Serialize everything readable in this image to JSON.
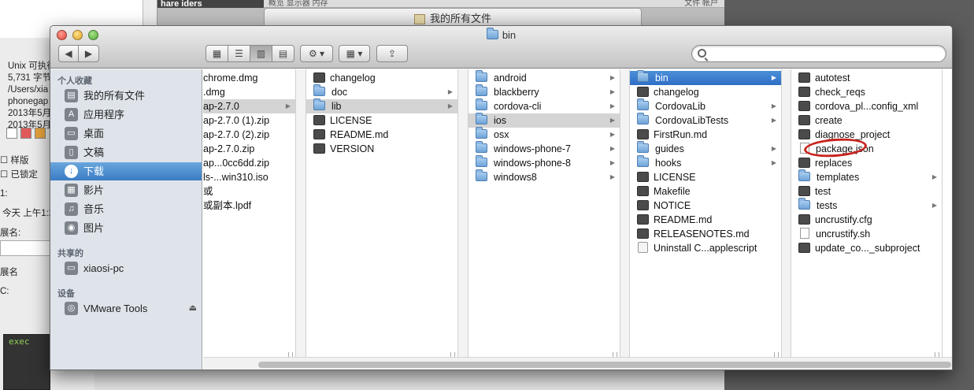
{
  "background": {
    "strip_text": "hare  iders",
    "top_bar_left": "概览  显示器  内存",
    "top_bar_right": "文件   帐户",
    "window2_title": "我的所有文件",
    "info_lines": "Unix 可执行\n5,731 字节\n/Users/xia\nphonegap\n2013年5月\n2013年5月",
    "chk_template": "样版",
    "chk_locked": "已锁定",
    "label_where": "1:",
    "label_today": "今天 上午1:2",
    "label_ext": "展名:",
    "label_ext2": "展名",
    "label_c": "C:",
    "terminal_text": "exec"
  },
  "window": {
    "title": "bin",
    "toolbar": {
      "back": "◀",
      "forward": "▶",
      "view_icon": "▦",
      "view_list": "☰",
      "view_column": "▥",
      "view_coverflow": "▤",
      "action": "⚙ ▾",
      "arrange": "▦ ▾",
      "share": "⇪"
    },
    "search": {
      "value": "",
      "placeholder": ""
    }
  },
  "sidebar": {
    "favorites_header": "个人收藏",
    "favorites": [
      {
        "label": "我的所有文件",
        "icon": "▤"
      },
      {
        "label": "应用程序",
        "icon": "A"
      },
      {
        "label": "桌面",
        "icon": "▭"
      },
      {
        "label": "文稿",
        "icon": "▯"
      },
      {
        "label": "下载",
        "icon": "↓"
      },
      {
        "label": "影片",
        "icon": "▦"
      },
      {
        "label": "音乐",
        "icon": "♫"
      },
      {
        "label": "图片",
        "icon": "◉"
      }
    ],
    "shared_header": "共享的",
    "shared": [
      {
        "label": "xiaosi-pc",
        "icon": "▭"
      }
    ],
    "devices_header": "设备",
    "devices": [
      {
        "label": "VMware Tools",
        "icon": "◎",
        "eject": "⏏"
      }
    ]
  },
  "columns": [
    {
      "items": [
        {
          "label": "chrome.dmg"
        },
        {
          "label": ".dmg"
        },
        {
          "label": "ap-2.7.0",
          "arrow": "▶",
          "sel": "grey"
        },
        {
          "label": "ap-2.7.0 (1).zip"
        },
        {
          "label": "ap-2.7.0 (2).zip"
        },
        {
          "label": "ap-2.7.0.zip"
        },
        {
          "label": "ap...0cc6dd.zip"
        },
        {
          "label": "ls-...win310.iso"
        },
        {
          "label": "或"
        },
        {
          "label": "或副本.lpdf"
        }
      ]
    },
    {
      "items": [
        {
          "label": "changelog",
          "kind": "file"
        },
        {
          "label": "doc",
          "kind": "folder",
          "arrow": "▶"
        },
        {
          "label": "lib",
          "kind": "folder",
          "arrow": "▶",
          "sel": "grey"
        },
        {
          "label": "LICENSE",
          "kind": "file"
        },
        {
          "label": "README.md",
          "kind": "file"
        },
        {
          "label": "VERSION",
          "kind": "file"
        }
      ]
    },
    {
      "items": [
        {
          "label": "android",
          "kind": "folder",
          "arrow": "▶"
        },
        {
          "label": "blackberry",
          "kind": "folder",
          "arrow": "▶"
        },
        {
          "label": "cordova-cli",
          "kind": "folder",
          "arrow": "▶"
        },
        {
          "label": "ios",
          "kind": "folder",
          "arrow": "▶",
          "sel": "grey"
        },
        {
          "label": "osx",
          "kind": "folder",
          "arrow": "▶"
        },
        {
          "label": "windows-phone-7",
          "kind": "folder",
          "arrow": "▶"
        },
        {
          "label": "windows-phone-8",
          "kind": "folder",
          "arrow": "▶"
        },
        {
          "label": "windows8",
          "kind": "folder",
          "arrow": "▶"
        }
      ]
    },
    {
      "items": [
        {
          "label": "bin",
          "kind": "folder",
          "arrow": "▶",
          "sel": "blue"
        },
        {
          "label": "changelog",
          "kind": "file"
        },
        {
          "label": "CordovaLib",
          "kind": "folder",
          "arrow": "▶"
        },
        {
          "label": "CordovaLibTests",
          "kind": "folder",
          "arrow": "▶"
        },
        {
          "label": "FirstRun.md",
          "kind": "file"
        },
        {
          "label": "guides",
          "kind": "folder",
          "arrow": "▶"
        },
        {
          "label": "hooks",
          "kind": "folder",
          "arrow": "▶"
        },
        {
          "label": "LICENSE",
          "kind": "file"
        },
        {
          "label": "Makefile",
          "kind": "file"
        },
        {
          "label": "NOTICE",
          "kind": "file"
        },
        {
          "label": "README.md",
          "kind": "file"
        },
        {
          "label": "RELEASENOTES.md",
          "kind": "file"
        },
        {
          "label": "Uninstall C...applescript",
          "kind": "script"
        }
      ]
    },
    {
      "items": [
        {
          "label": "autotest",
          "kind": "file"
        },
        {
          "label": "check_reqs",
          "kind": "file"
        },
        {
          "label": "cordova_pl...config_xml",
          "kind": "file"
        },
        {
          "label": "create",
          "kind": "file"
        },
        {
          "label": "diagnose_project",
          "kind": "file"
        },
        {
          "label": "package.json",
          "kind": "doc"
        },
        {
          "label": "replaces",
          "kind": "file"
        },
        {
          "label": "templates",
          "kind": "folder",
          "arrow": "▶"
        },
        {
          "label": "test",
          "kind": "file"
        },
        {
          "label": "tests",
          "kind": "folder",
          "arrow": "▶"
        },
        {
          "label": "uncrustify.cfg",
          "kind": "file"
        },
        {
          "label": "uncrustify.sh",
          "kind": "doc"
        },
        {
          "label": "update_co..._subproject",
          "kind": "file"
        }
      ]
    }
  ]
}
